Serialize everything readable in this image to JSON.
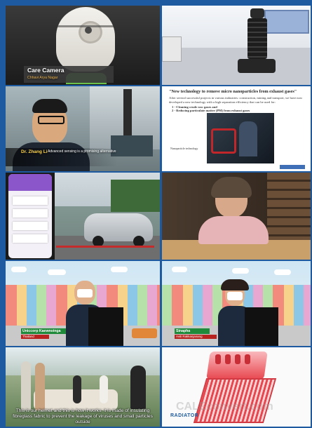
{
  "tiles": [
    {
      "caption_title": "Care Camera",
      "caption_sub": "Chhavi Arya Nagar"
    },
    {},
    {
      "caption_name": "Dr. Zhang Li",
      "caption_line": "Advanced sensing is a promising alternative"
    },
    {
      "title": "\"New technology to remove micro nanoparticles from exhaust gases\"",
      "body": "After several successful projects in various industries: construction, mining and transport, we have now developed a new technology with a high separation efficiency that can be used for:",
      "items": [
        "1 - Cleaning crude raw gases and",
        "2 - Reducing particulate matter (PM) from exhaust gases"
      ],
      "side_caption": "Nanoparticle technology"
    },
    {},
    {},
    {
      "lower_name": "Uniccorp Kaewnoinga",
      "lower_sub": "Thailand"
    },
    {
      "lower_name": "Sinapha",
      "lower_sub": "Aviti Rakkanjanang"
    },
    {
      "subtitle": "This is our helmet and this is how it works: it is made of insulating fibreglass fabric to prevent the leakage of viruses and small particles outside"
    },
    {
      "brand": "RADIATOR",
      "watermark": "CALEconvert.com"
    }
  ],
  "colors": {
    "border": "#1e5aa0",
    "caption_bg": "#3a3a3a",
    "lower_green": "#1f8a3a",
    "lower_red": "#b8231f",
    "radiator_red": "#e8464e"
  }
}
